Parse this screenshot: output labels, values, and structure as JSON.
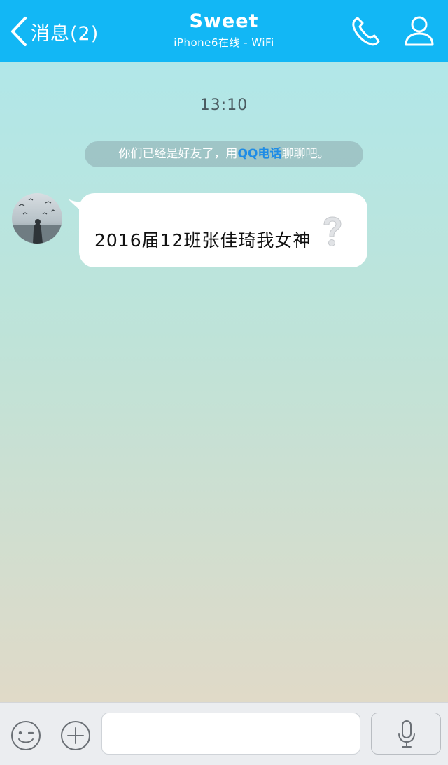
{
  "header": {
    "back_label": "消息(2)",
    "title": "Sweet",
    "subtitle": "iPhone6在线 - WiFi",
    "icons": {
      "back": "chevron-left-icon",
      "call": "phone-icon",
      "profile": "contact-icon"
    }
  },
  "chat": {
    "timestamp": "13:10",
    "system_notice": {
      "prefix": "你们已经是好友了，用",
      "link": "QQ电话",
      "suffix": "聊聊吧。"
    },
    "messages": [
      {
        "direction": "incoming",
        "text": "2016届12班张佳琦我女神",
        "emoji": "question-mark-icon"
      }
    ]
  },
  "input_bar": {
    "icons": {
      "emoji": "emoji-icon",
      "more": "plus-icon",
      "voice": "microphone-icon"
    },
    "text_value": ""
  },
  "colors": {
    "header_bg": "#12b7f5",
    "link": "#1e8ce6",
    "bubble_bg": "#ffffff",
    "background_top": "#aee8ec",
    "background_bottom": "#e6d8c5"
  }
}
